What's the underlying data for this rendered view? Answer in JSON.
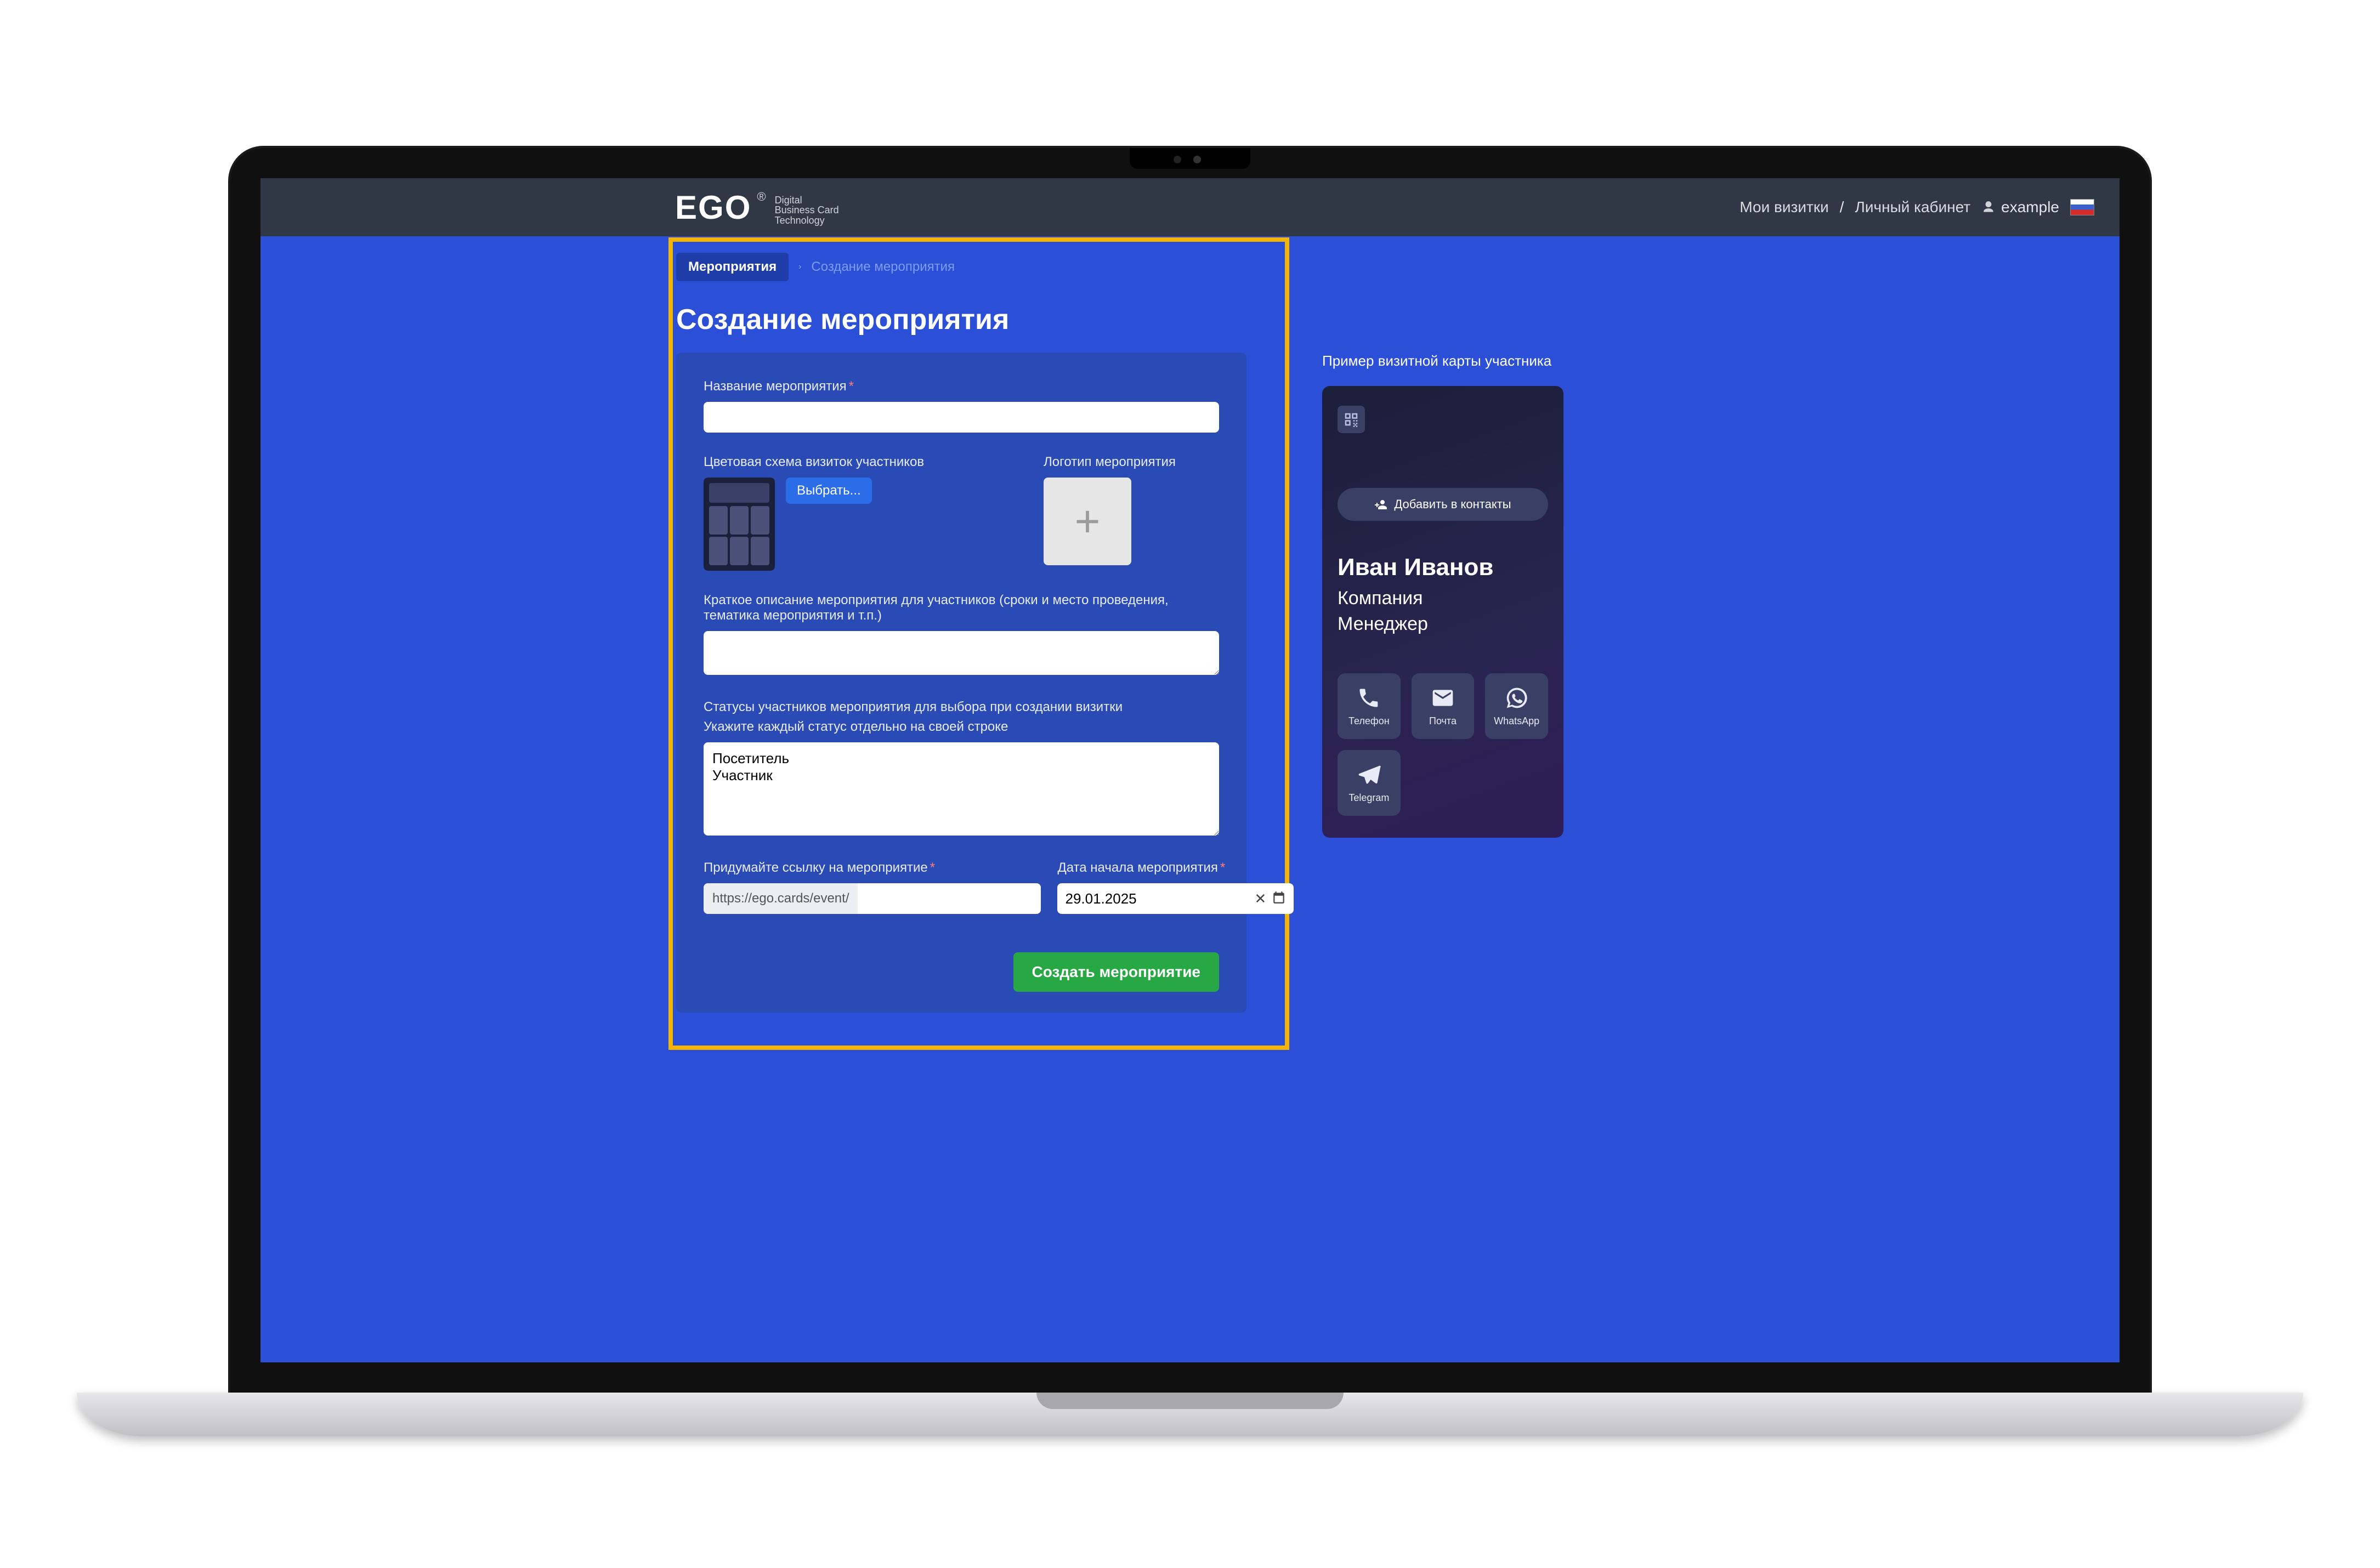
{
  "header": {
    "logo_main": "EGO",
    "logo_reg": "®",
    "logo_sub_l1": "Digital",
    "logo_sub_l2": "Business Card",
    "logo_sub_l3": "Technology",
    "nav_my_cards": "Мои визитки",
    "nav_divider": "/",
    "nav_account": "Личный кабинет",
    "user_name": "example"
  },
  "tabs": {
    "events": "Мероприятия",
    "create": "Создание мероприятия"
  },
  "page_title": "Создание мероприятия",
  "form": {
    "name_label": "Название мероприятия",
    "scheme_label": "Цветовая схема визиток участников",
    "scheme_button": "Выбрать...",
    "logo_label": "Логотип мероприятия",
    "desc_label": "Краткое описание мероприятия для участников (сроки и место проведения, тематика мероприятия и т.п.)",
    "status_label_1": "Статусы участников мероприятия для выбора при создании визитки",
    "status_label_2": "Укажите каждый статус отдельно на своей строке",
    "status_value": "Посетитель\nУчастник",
    "link_label": "Придумайте ссылку на мероприятие",
    "link_prefix": "https://ego.cards/event/",
    "date_label": "Дата начала мероприятия",
    "date_value": "29.01.2025",
    "submit": "Создать мероприятие"
  },
  "preview": {
    "title": "Пример визитной карты участника",
    "add_contact": "Добавить в контакты",
    "name": "Иван Иванов",
    "company": "Компания",
    "role": "Менеджер",
    "contacts": {
      "phone": "Телефон",
      "mail": "Почта",
      "whatsapp": "WhatsApp",
      "telegram": "Telegram"
    }
  }
}
